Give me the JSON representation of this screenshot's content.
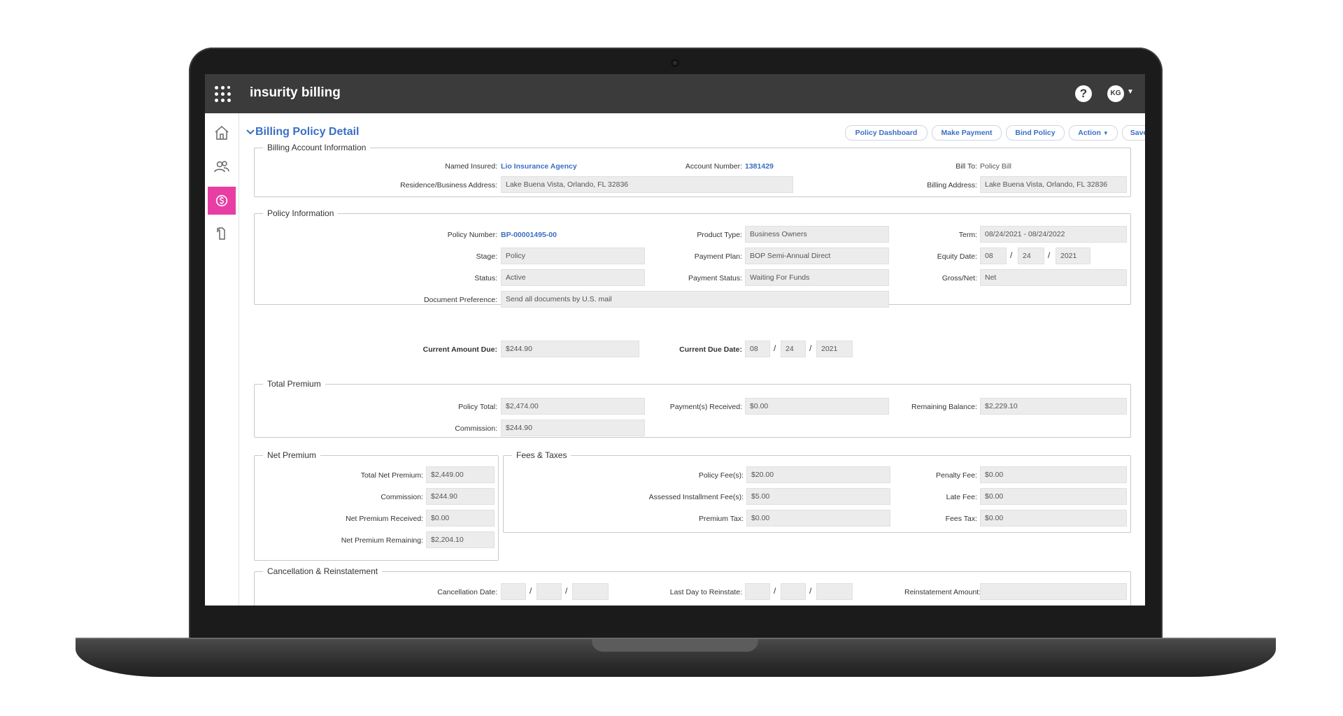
{
  "app": {
    "title": "insurity billing",
    "help_glyph": "?",
    "avatar_initials": "KG"
  },
  "page": {
    "title": "Billing Policy Detail",
    "buttons": {
      "policy_dashboard": "Policy Dashboard",
      "make_payment": "Make Payment",
      "bind_policy": "Bind Policy",
      "action": "Action",
      "save": "Save"
    }
  },
  "billing_account": {
    "legend": "Billing Account Information",
    "named_insured_label": "Named Insured:",
    "named_insured": "Lio Insurance Agency",
    "account_number_label": "Account Number:",
    "account_number": "1381429",
    "bill_to_label": "Bill To:",
    "bill_to": "Policy Bill",
    "residence_label": "Residence/Business Address:",
    "residence": "Lake Buena Vista, Orlando, FL 32836",
    "billing_address_label": "Billing Address:",
    "billing_address": "Lake Buena Vista, Orlando, FL 32836"
  },
  "policy_info": {
    "legend": "Policy Information",
    "policy_number_label": "Policy Number:",
    "policy_number": "BP-00001495-00",
    "product_type_label": "Product Type:",
    "product_type": "Business Owners",
    "term_label": "Term:",
    "term": "08/24/2021 - 08/24/2022",
    "stage_label": "Stage:",
    "stage": "Policy",
    "payment_plan_label": "Payment Plan:",
    "payment_plan": "BOP Semi-Annual Direct",
    "equity_date_label": "Equity Date:",
    "equity_month": "08",
    "equity_day": "24",
    "equity_year": "2021",
    "status_label": "Status:",
    "status": "Active",
    "payment_status_label": "Payment Status:",
    "payment_status": "Waiting For Funds",
    "gross_net_label": "Gross/Net:",
    "gross_net": "Net",
    "doc_pref_label": "Document Preference:",
    "doc_pref": "Send all documents by U.S. mail"
  },
  "current": {
    "amount_due_label": "Current Amount Due:",
    "amount_due": "$244.90",
    "due_date_label": "Current Due Date:",
    "due_month": "08",
    "due_day": "24",
    "due_year": "2021"
  },
  "total_premium": {
    "legend": "Total Premium",
    "policy_total_label": "Policy Total:",
    "policy_total": "$2,474.00",
    "payments_received_label": "Payment(s) Received:",
    "payments_received": "$0.00",
    "remaining_balance_label": "Remaining Balance:",
    "remaining_balance": "$2,229.10",
    "commission_label": "Commission:",
    "commission": "$244.90"
  },
  "net_premium": {
    "legend": "Net Premium",
    "total_net_label": "Total Net Premium:",
    "total_net": "$2,449.00",
    "commission_label": "Commission:",
    "commission": "$244.90",
    "received_label": "Net Premium Received:",
    "received": "$0.00",
    "remaining_label": "Net Premium Remaining:",
    "remaining": "$2,204.10"
  },
  "fees_taxes": {
    "legend": "Fees & Taxes",
    "policy_fees_label": "Policy Fee(s):",
    "policy_fees": "$20.00",
    "installment_label": "Assessed Installment Fee(s):",
    "installment": "$5.00",
    "premium_tax_label": "Premium Tax:",
    "premium_tax": "$0.00",
    "penalty_label": "Penalty Fee:",
    "penalty": "$0.00",
    "late_label": "Late Fee:",
    "late": "$0.00",
    "fees_tax_label": "Fees Tax:",
    "fees_tax": "$0.00"
  },
  "cancellation": {
    "legend": "Cancellation & Reinstatement",
    "cancel_date_label": "Cancellation Date:",
    "last_day_label": "Last Day to Reinstate:",
    "reinstate_amount_label": "Reinstatement Amount:"
  },
  "date_separator": "/",
  "colors": {
    "accent": "#3a6fc4",
    "topbar": "#3b3b3b",
    "active_nav": "#e83ea4"
  }
}
